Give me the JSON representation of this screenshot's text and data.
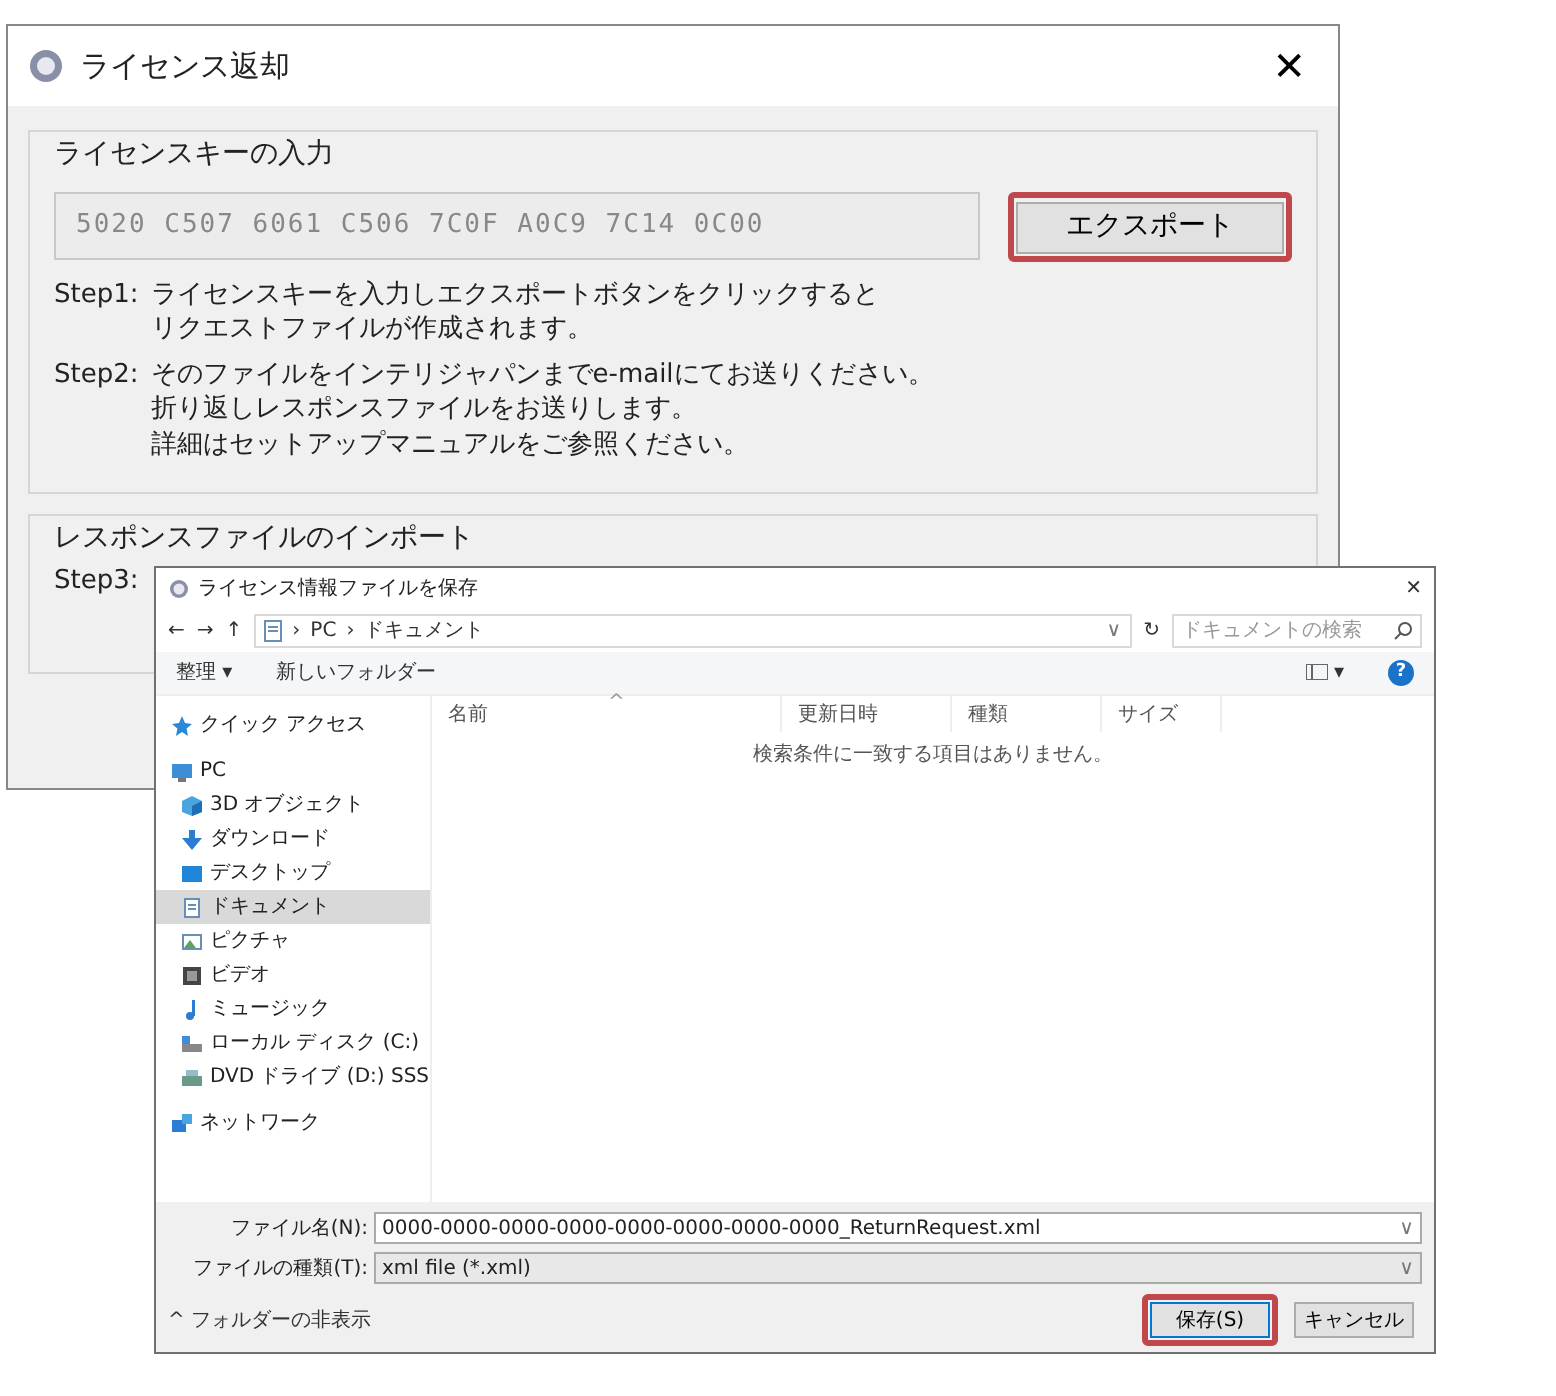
{
  "main_window": {
    "title": "ライセンス返却",
    "close": "✕",
    "key_group": {
      "title": "ライセンスキーの入力",
      "key_value": "5020 C507 6061 C506 7C0F A0C9 7C14 0C00",
      "export_button": {
        "label": "エクスポート",
        "highlighted": true
      },
      "steps": [
        {
          "label": "Step1:",
          "lines": [
            "ライセンスキーを入力しエクスポートボタンをクリックすると",
            "リクエストファイルが作成されます。"
          ]
        },
        {
          "label": "Step2:",
          "lines": [
            "そのファイルをインテリジャパンまでe-mailにてお送りください。",
            "折り返しレスポンスファイルをお送りします。",
            "詳細はセットアップマニュアルをご参照ください。"
          ]
        }
      ]
    },
    "import_group": {
      "title": "レスポンスファイルのインポート",
      "step_label": "Step3:"
    }
  },
  "save_dialog": {
    "title": "ライセンス情報ファイルを保存",
    "close": "✕",
    "nav": {
      "back": "←",
      "forward": "→",
      "up": "↑",
      "path": [
        "PC",
        "ドキュメント"
      ],
      "separator": "›",
      "dropdown": "∨",
      "refresh": "↻",
      "search_placeholder": "ドキュメントの検索"
    },
    "toolbar": {
      "organize": "整理 ▾",
      "new_folder": "新しいフォルダー",
      "view_caret": "▾",
      "help": "?"
    },
    "sidebar": {
      "items": [
        {
          "label": "クイック アクセス",
          "kind": "star",
          "selected": false
        },
        {
          "label": "PC",
          "kind": "pc",
          "selected": false,
          "children": [
            {
              "label": "3D オブジェクト",
              "kind": "cube",
              "selected": false
            },
            {
              "label": "ダウンロード",
              "kind": "download",
              "selected": false
            },
            {
              "label": "デスクトップ",
              "kind": "desktop",
              "selected": false
            },
            {
              "label": "ドキュメント",
              "kind": "document",
              "selected": true
            },
            {
              "label": "ピクチャ",
              "kind": "picture",
              "selected": false
            },
            {
              "label": "ビデオ",
              "kind": "video",
              "selected": false
            },
            {
              "label": "ミュージック",
              "kind": "music",
              "selected": false
            },
            {
              "label": "ローカル ディスク (C:)",
              "kind": "disk",
              "selected": false
            },
            {
              "label": "DVD ドライブ (D:) SSS",
              "kind": "dvd",
              "selected": false
            }
          ]
        },
        {
          "label": "ネットワーク",
          "kind": "network",
          "selected": false
        }
      ]
    },
    "file_list": {
      "columns": [
        "名前",
        "更新日時",
        "種類",
        "サイズ"
      ],
      "sort_mark": "^",
      "empty_message": "検索条件に一致する項目はありません。"
    },
    "file_name": {
      "label": "ファイル名(N):",
      "value": "0000-0000-0000-0000-0000-0000-0000-0000_ReturnRequest.xml"
    },
    "file_type": {
      "label": "ファイルの種類(T):",
      "value": "xml file (*.xml)"
    },
    "hide_folders": {
      "caret": "^",
      "label": "フォルダーの非表示"
    },
    "buttons": [
      {
        "label": "保存(S)",
        "kind": "primary",
        "highlighted": true
      },
      {
        "label": "キャンセル",
        "kind": "secondary",
        "highlighted": false
      }
    ]
  }
}
